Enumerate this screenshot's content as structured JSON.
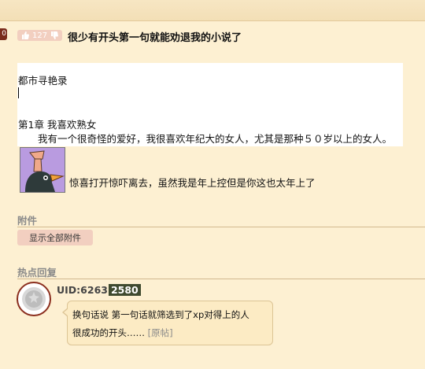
{
  "topbar": {},
  "edge_tab": {
    "label": "0"
  },
  "post": {
    "vote_count": "127",
    "title": "很少有开头第一句就能劝退我的小说了",
    "book_title": "都市寻艳录",
    "chapter": "第1章  我喜欢熟女",
    "paragraph": "我有一个很奇怪的爱好，我很喜欢年纪大的女人，尤其是那种５０岁以上的女人。",
    "comment": "惊喜打开惊吓离去，虽然我是年上控但是你这也太年上了"
  },
  "attachments": {
    "heading": "附件",
    "show_all_label": "显示全部附件"
  },
  "hot_replies": {
    "heading": "热点回复",
    "uid_prefix": "UID:6263",
    "uid_highlight": "2580",
    "line1": "换句话说 第一句话就筛选到了xp对得上的人",
    "line2": "很成功的开头……",
    "original_link": "[原帖]"
  },
  "colors": {
    "background": "#fdf0d2",
    "pill": "#f2cfc0",
    "accent_dark": "#8b2e1e",
    "uid_highlight_bg": "#3f4a2f"
  }
}
